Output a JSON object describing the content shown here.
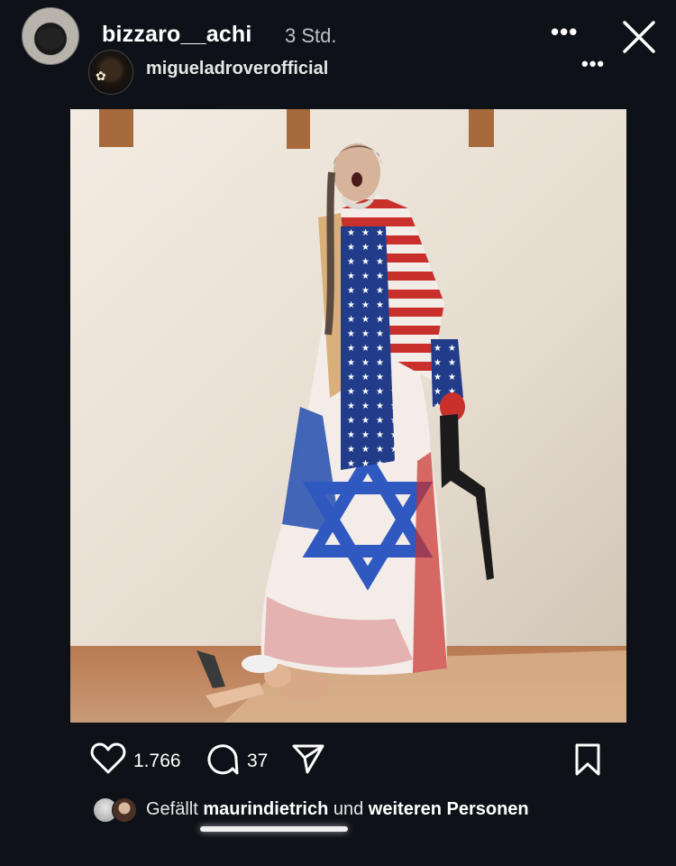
{
  "header": {
    "username": "bizzaro__achi",
    "timestamp": "3 Std.",
    "shared_from": "migueladroverofficial",
    "more_label": "•••",
    "sub_more_label": "•••"
  },
  "post": {
    "likes_count": "1.766",
    "comments_count": "37",
    "liked_by_prefix": "Gefällt",
    "liked_by_user": "maurindietrich",
    "liked_by_connector": "und",
    "liked_by_suffix": "weiteren Personen"
  },
  "icons": {
    "close": "close-icon",
    "like": "heart-icon",
    "comment": "comment-icon",
    "share": "send-icon",
    "save": "bookmark-icon"
  }
}
